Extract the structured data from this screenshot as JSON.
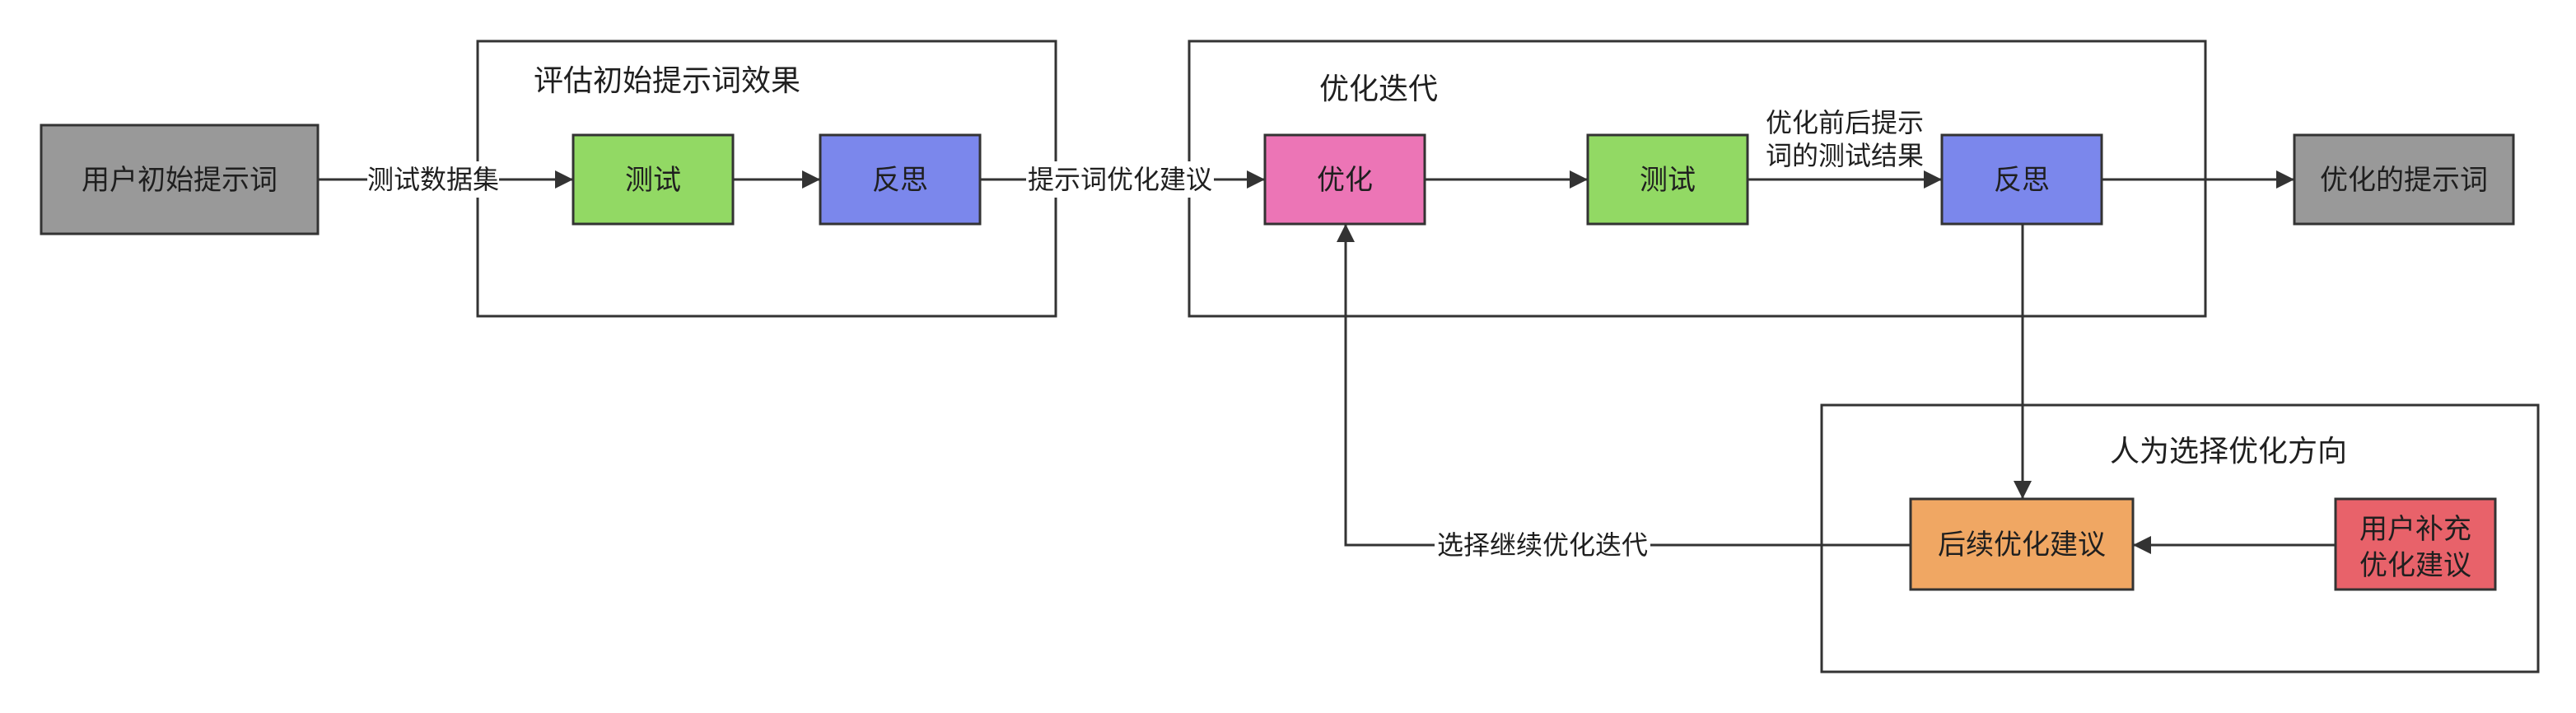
{
  "colors": {
    "gray": "#999999",
    "green": "#92d964",
    "blue": "#7b87ec",
    "pink": "#ec75b6",
    "orange": "#f0a763",
    "red": "#e8626a",
    "stroke": "#333333",
    "background": "#ffffff"
  },
  "groups": {
    "evaluate": {
      "title": "评估初始提示词效果"
    },
    "optimize": {
      "title": "优化迭代"
    },
    "human": {
      "title": "人为选择优化方向"
    }
  },
  "nodes": {
    "initial_prompt": "用户初始提示词",
    "eval_test": "测试",
    "eval_reflect": "反思",
    "optimize": "优化",
    "opt_test": "测试",
    "opt_reflect": "反思",
    "optimized_prompt": "优化的提示词",
    "followup_suggestion": "后续优化建议",
    "user_supplement": [
      "用户补充",
      "优化建议"
    ]
  },
  "edges": {
    "test_dataset": "测试数据集",
    "prompt_suggestion": "提示词优化建议",
    "before_after_results": [
      "优化前后提示",
      "词的测试结果"
    ],
    "continue_iteration": "选择继续优化迭代"
  }
}
